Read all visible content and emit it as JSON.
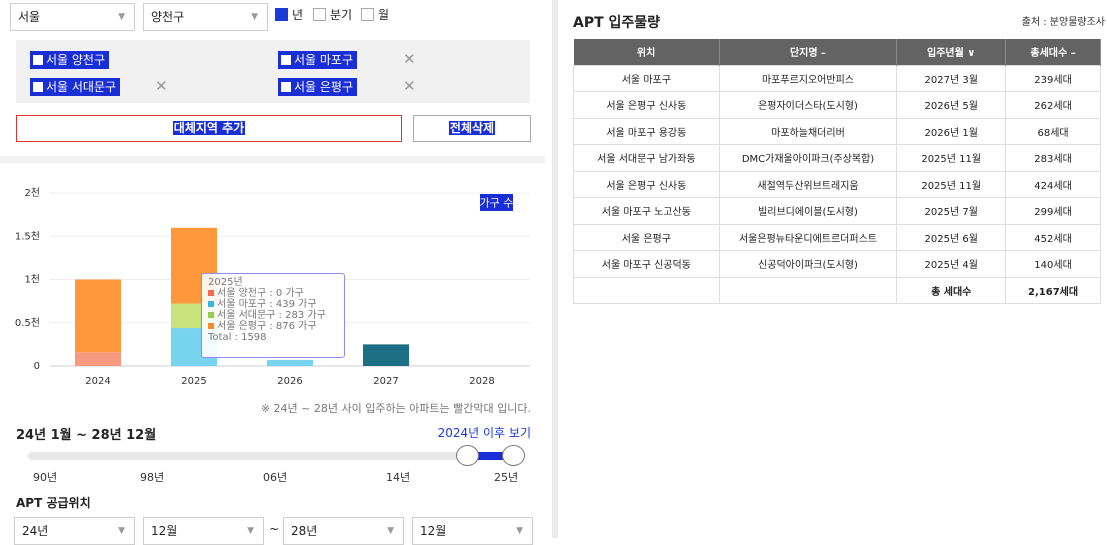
{
  "filters": {
    "city": "서울",
    "district": "양천구",
    "period_options": [
      {
        "label": "년",
        "checked": true
      },
      {
        "label": "분기",
        "checked": false
      },
      {
        "label": "월",
        "checked": false
      }
    ]
  },
  "regions": [
    {
      "label": "서울 양천구",
      "removable": false
    },
    {
      "label": "서울 마포구",
      "removable": true
    },
    {
      "label": "서울 서대문구",
      "removable": true
    },
    {
      "label": "서울 은평구",
      "removable": true
    }
  ],
  "buttons": {
    "add_region": "대체지역 추가",
    "delete_all": "전체삭제"
  },
  "chart_data": {
    "type": "bar",
    "stacked": true,
    "categories": [
      "2024",
      "2025",
      "2026",
      "2027",
      "2028"
    ],
    "series": [
      {
        "name": "서울 양천구",
        "color": "#f89a80",
        "values": [
          160,
          0,
          0,
          0,
          0
        ]
      },
      {
        "name": "서울 마포구",
        "color": "#78d3ee",
        "values": [
          0,
          439,
          70,
          0,
          0
        ]
      },
      {
        "name": "서울 서대문구",
        "color": "#c8e37c",
        "values": [
          0,
          283,
          0,
          0,
          0
        ]
      },
      {
        "name": "서울 은평구",
        "color": "#fe983c",
        "values": [
          840,
          876,
          0,
          0,
          0
        ]
      },
      {
        "name": "",
        "color": "#1c6f85",
        "values": [
          0,
          0,
          0,
          250,
          0
        ]
      }
    ],
    "y_ticks": [
      "0",
      "0.5천",
      "1천",
      "1.5천",
      "2천"
    ],
    "ylim": [
      0,
      2000
    ],
    "legend_label": "가구 수",
    "tooltip": {
      "title": "2025년",
      "rows": [
        {
          "text": "서울 양천구 : 0 가구",
          "color": "#f46a4e"
        },
        {
          "text": "서울 마포구 : 439 가구",
          "color": "#3ab7e0"
        },
        {
          "text": "서울 서대문구 : 283 가구",
          "color": "#8fcf4c"
        },
        {
          "text": "서울 은평구 : 876 가구",
          "color": "#f98b2b"
        }
      ],
      "total": "Total : 1598"
    }
  },
  "note": "※ 24년 ~ 28년 사이 입주하는 아파트는 빨간막대 입니다.",
  "range_label": "24년 1월 ~ 28년 12월",
  "after_link": "2024년 이후 보기",
  "slider": {
    "labels": [
      "90년",
      "98년",
      "06년",
      "14년",
      "25년"
    ],
    "start_fraction": 0.9,
    "end_fraction": 1.0
  },
  "supply_title": "APT 공급위치",
  "bottom_selects": {
    "from_year": "24년",
    "from_month": "12월",
    "tilde": "~",
    "to_year": "28년",
    "to_month": "12월"
  },
  "right": {
    "title": "APT 입주물량",
    "source": "출처 : 분양물량조사",
    "headers": [
      "위치",
      "단지명 –",
      "입주년월 ∨",
      "총세대수 –"
    ],
    "rows": [
      [
        "서울 마포구",
        "마포푸르지오어반피스",
        "2027년 3월",
        "239세대"
      ],
      [
        "서울 은평구 신사동",
        "은평자이더스타(도시형)",
        "2026년 5월",
        "262세대"
      ],
      [
        "서울 마포구 용강동",
        "마포하늘채더리버",
        "2026년 1월",
        "68세대"
      ],
      [
        "서울 서대문구 남가좌동",
        "DMC가재울아이파크(주상복합)",
        "2025년 11월",
        "283세대"
      ],
      [
        "서울 은평구 신사동",
        "새절역두산위브트레지움",
        "2025년 11월",
        "424세대"
      ],
      [
        "서울 마포구 노고산동",
        "빌리브디에이블(도시형)",
        "2025년 7월",
        "299세대"
      ],
      [
        "서울 은평구",
        "서울은평뉴타운디에트르더퍼스트",
        "2025년 6월",
        "452세대"
      ],
      [
        "서울 마포구 신공덕동",
        "신공덕아이파크(도시형)",
        "2025년 4월",
        "140세대"
      ]
    ],
    "total_label": "총 세대수",
    "total_value": "2,167세대"
  }
}
